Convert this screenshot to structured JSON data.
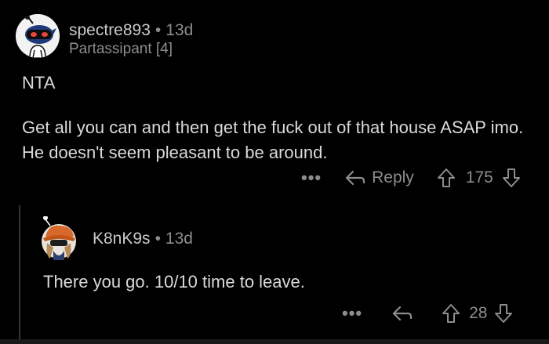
{
  "comments": [
    {
      "username": "spectre893",
      "time": "13d",
      "flair": "Partassipant [4]",
      "body": [
        "NTA",
        "Get all you can and then get the fuck out of that house ASAP imo. He doesn't seem pleasant to be around."
      ],
      "actions": {
        "more": "•••",
        "reply_label": "Reply",
        "score": "175"
      }
    },
    {
      "username": "K8nK9s",
      "time": "13d",
      "body": [
        "There you go. 10/10 time to leave."
      ],
      "actions": {
        "more": "•••",
        "reply_label": "",
        "score": "28"
      }
    }
  ],
  "separator": "•",
  "colors": {
    "background": "#000000",
    "text": "#d7dadc",
    "meta": "#8a8d8f",
    "thread_line": "#343536",
    "avatar_red": "#e8483b",
    "avatar_orange": "#d9692a"
  }
}
